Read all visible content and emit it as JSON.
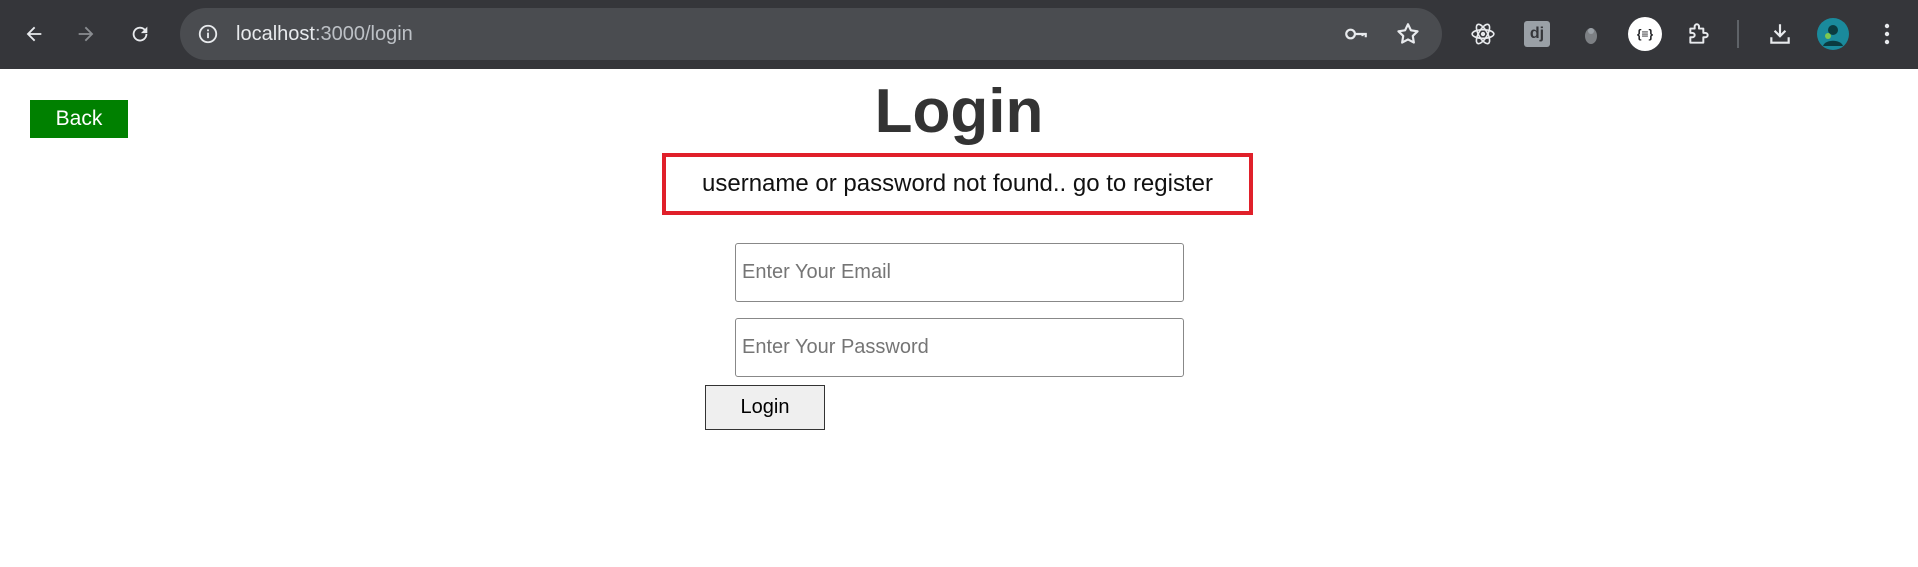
{
  "browser": {
    "url_host": "localhost",
    "url_path": ":3000/login",
    "icons": {
      "back": "arrow-left-icon",
      "forward": "arrow-right-icon",
      "reload": "reload-icon",
      "site_info": "info-icon",
      "password": "key-icon",
      "bookmark": "star-icon",
      "extensions": [
        "react-devtools-icon",
        "django-icon",
        "extension-gray-icon",
        "json-formatter-icon",
        "puzzle-icon"
      ],
      "download": "download-icon",
      "profile": "avatar-icon",
      "menu": "kebab-menu-icon"
    },
    "json_ext_label": "{≡}",
    "django_label": "dj"
  },
  "page": {
    "back_label": "Back",
    "title": "Login",
    "error_message": "username or password not found.. go to register",
    "email_placeholder": "Enter Your Email",
    "password_placeholder": "Enter Your Password",
    "login_label": "Login"
  },
  "colors": {
    "chrome_bg": "#35363a",
    "back_button": "#008000",
    "error_border": "#e0202a",
    "title": "#333333"
  }
}
